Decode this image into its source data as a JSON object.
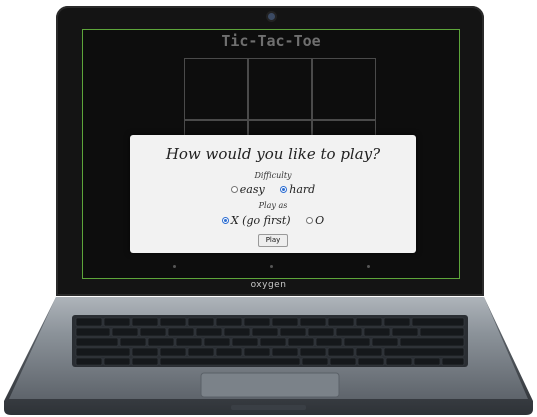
{
  "device": {
    "brand": "oxygen"
  },
  "game": {
    "title": "Tic-Tac-Toe",
    "board_cells": [
      "",
      "",
      "",
      "",
      "",
      "",
      "",
      "",
      ""
    ]
  },
  "dialog": {
    "question": "How would you like to play?",
    "difficulty_label": "Difficulty",
    "difficulty_options": [
      {
        "label": "easy",
        "selected": false
      },
      {
        "label": "hard",
        "selected": true
      }
    ],
    "play_as_label": "Play as",
    "play_as_options": [
      {
        "label": "X (go first)",
        "selected": true
      },
      {
        "label": "O",
        "selected": false
      }
    ],
    "play_button": "Play"
  }
}
